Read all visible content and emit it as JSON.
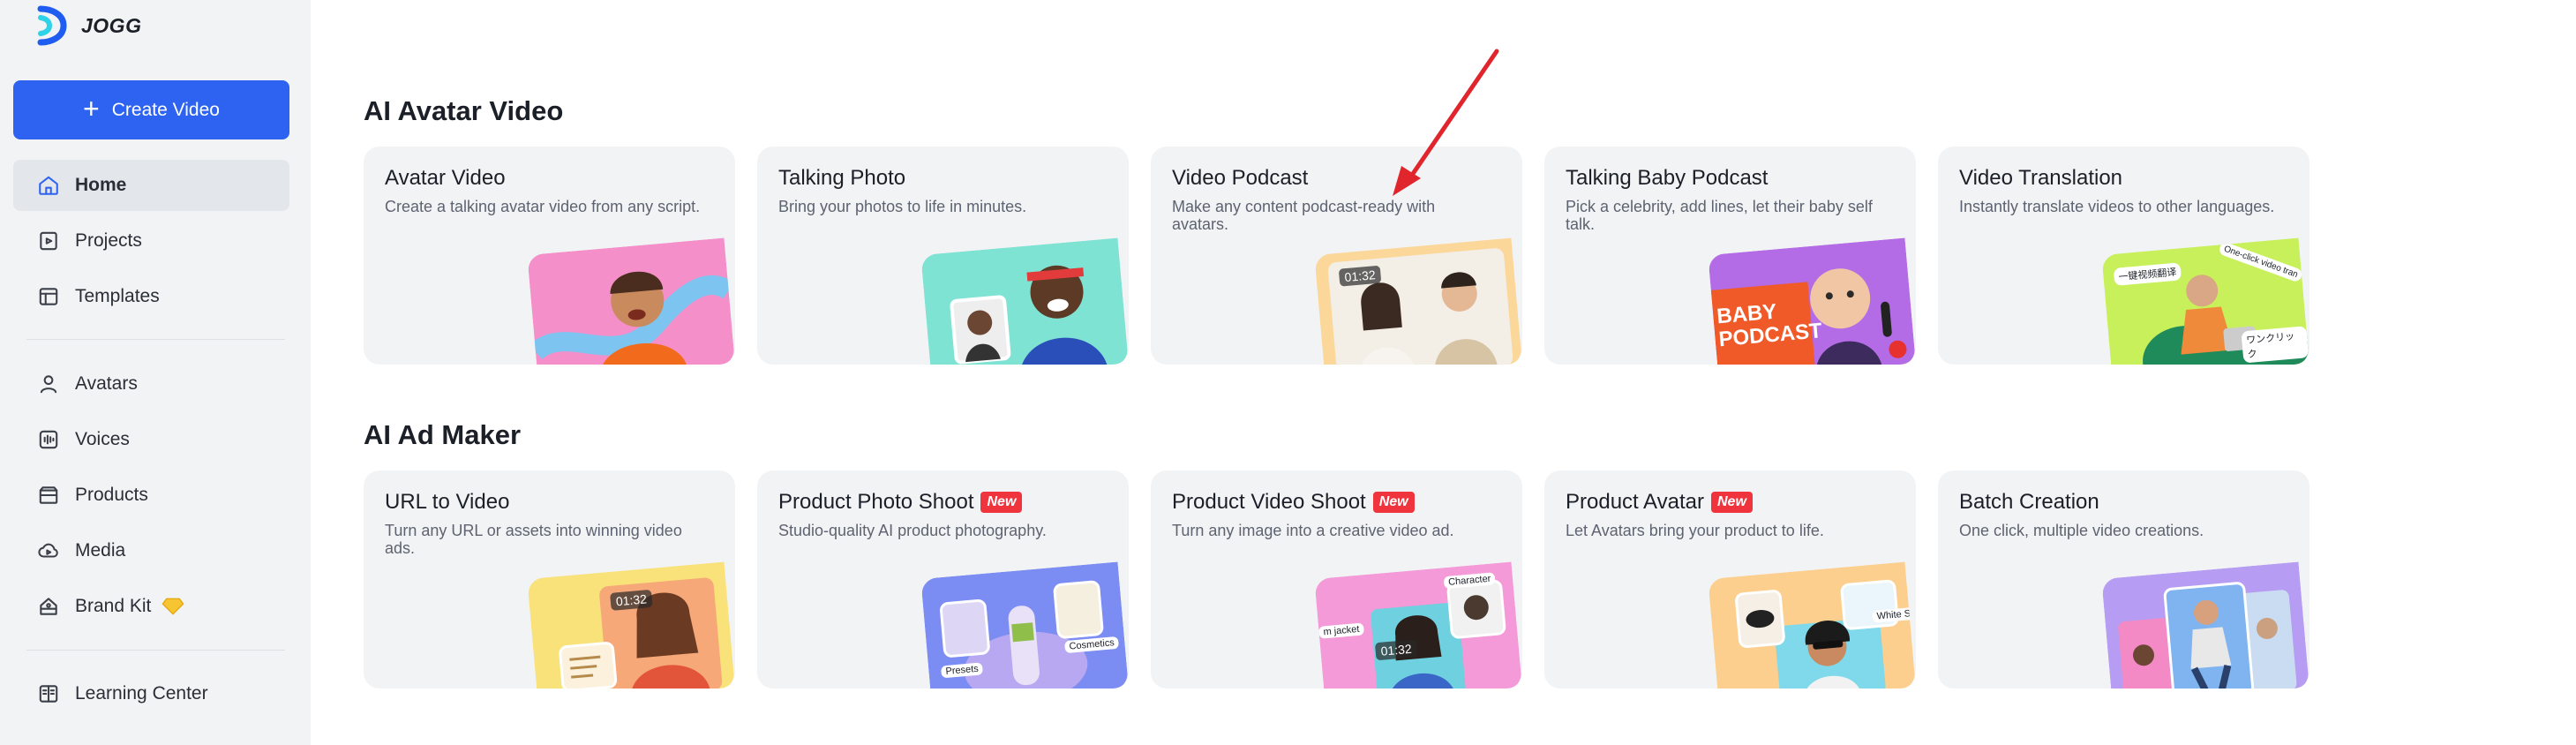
{
  "app": {
    "name": "JOGG"
  },
  "sidebar": {
    "create_label": "Create Video",
    "items": [
      {
        "label": "Home",
        "icon": "home-icon"
      },
      {
        "label": "Projects",
        "icon": "projects-icon"
      },
      {
        "label": "Templates",
        "icon": "templates-icon"
      },
      {
        "label": "Avatars",
        "icon": "avatar-icon"
      },
      {
        "label": "Voices",
        "icon": "voices-icon"
      },
      {
        "label": "Products",
        "icon": "products-icon"
      },
      {
        "label": "Media",
        "icon": "media-icon"
      },
      {
        "label": "Brand Kit",
        "icon": "brand-kit-icon"
      },
      {
        "label": "Learning Center",
        "icon": "learning-center-icon"
      }
    ],
    "active_item": "Home"
  },
  "sections": [
    {
      "title": "AI Avatar Video",
      "cards": [
        {
          "title": "Avatar Video",
          "desc": "Create a talking avatar video from any script."
        },
        {
          "title": "Talking Photo",
          "desc": "Bring your photos to life in minutes."
        },
        {
          "title": "Video Podcast",
          "desc": "Make any content podcast-ready with avatars.",
          "duration": "01:32"
        },
        {
          "title": "Talking Baby Podcast",
          "desc": "Pick a celebrity, add lines, let their baby self talk.",
          "thumb_text": "BABY PODCAST"
        },
        {
          "title": "Video Translation",
          "desc": "Instantly translate videos to other languages.",
          "thumb_text": [
            "一键视频翻译",
            "One-click video tran",
            "ワンクリック"
          ]
        }
      ]
    },
    {
      "title": "AI Ad Maker",
      "cards": [
        {
          "title": "URL to Video",
          "desc": "Turn any URL or assets into winning video ads.",
          "duration": "01:32"
        },
        {
          "title": "Product Photo Shoot",
          "badge": "New",
          "desc": "Studio-quality AI product photography.",
          "thumb_text": [
            "Presets",
            "Cosmetics"
          ]
        },
        {
          "title": "Product Video Shoot",
          "badge": "New",
          "desc": "Turn any image into a creative video ad.",
          "thumb_text": [
            "Character",
            "m jacket"
          ],
          "duration": "01:32"
        },
        {
          "title": "Product Avatar",
          "badge": "New",
          "desc": "Let Avatars bring your product to life.",
          "thumb_text": [
            "White S"
          ]
        },
        {
          "title": "Batch Creation",
          "desc": "One click, multiple video creations."
        }
      ]
    }
  ],
  "colors": {
    "accent": "#2d63f0",
    "badge": "#f0343e",
    "annotation_arrow": "#e0262c"
  }
}
